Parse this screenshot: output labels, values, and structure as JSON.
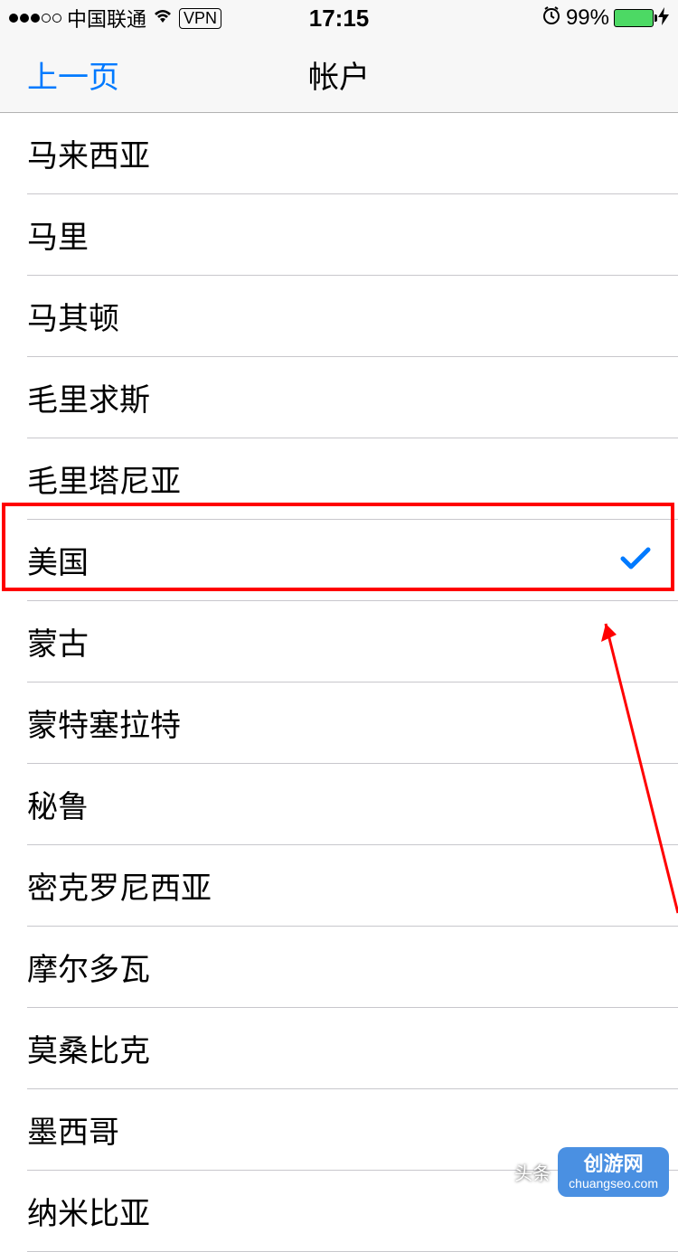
{
  "statusBar": {
    "carrier": "中国联通",
    "vpn": "VPN",
    "time": "17:15",
    "batteryPercent": "99%"
  },
  "navBar": {
    "back": "上一页",
    "title": "帐户"
  },
  "countries": [
    {
      "label": "马来西亚",
      "selected": false
    },
    {
      "label": "马里",
      "selected": false
    },
    {
      "label": "马其顿",
      "selected": false
    },
    {
      "label": "毛里求斯",
      "selected": false
    },
    {
      "label": "毛里塔尼亚",
      "selected": false
    },
    {
      "label": "美国",
      "selected": true
    },
    {
      "label": "蒙古",
      "selected": false
    },
    {
      "label": "蒙特塞拉特",
      "selected": false
    },
    {
      "label": "秘鲁",
      "selected": false
    },
    {
      "label": "密克罗尼西亚",
      "selected": false
    },
    {
      "label": "摩尔多瓦",
      "selected": false
    },
    {
      "label": "莫桑比克",
      "selected": false
    },
    {
      "label": "墨西哥",
      "selected": false
    },
    {
      "label": "纳米比亚",
      "selected": false
    }
  ],
  "watermark": {
    "text": "头条",
    "badgeLine1": "创游网",
    "badgeLine2": "chuangseo.com"
  }
}
